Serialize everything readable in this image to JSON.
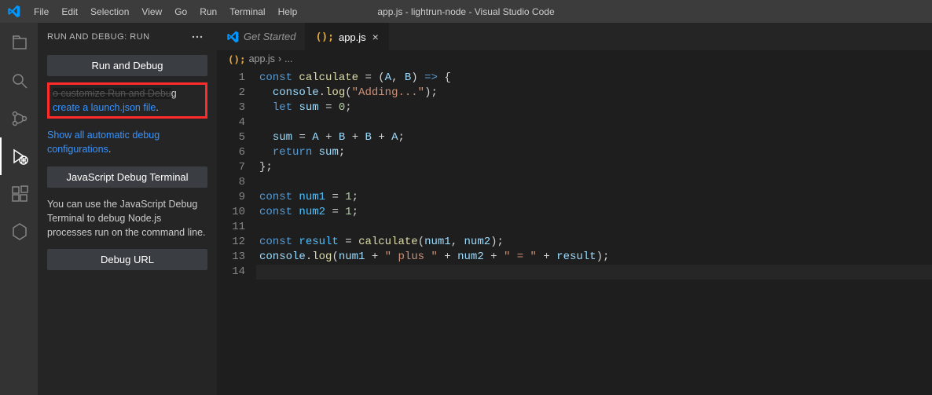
{
  "titlebar": {
    "title": "app.js - lightrun-node - Visual Studio Code",
    "menus": [
      "File",
      "Edit",
      "Selection",
      "View",
      "Go",
      "Run",
      "Terminal",
      "Help"
    ]
  },
  "activitybar": {
    "items": [
      "explorer",
      "search",
      "source-control",
      "run-debug",
      "extensions",
      "hexagon"
    ]
  },
  "sidebar": {
    "title": "RUN AND DEBUG: RUN",
    "run_and_debug_btn": "Run and Debug",
    "create_launch_line1_suffix": "g",
    "create_launch_link": "create a launch.json file",
    "create_launch_period": ".",
    "show_all_link": "Show all automatic debug configurations",
    "show_all_period": ".",
    "js_terminal_btn": "JavaScript Debug Terminal",
    "js_terminal_help": "You can use the JavaScript Debug Terminal to debug Node.js processes run on the command line.",
    "debug_url_btn": "Debug URL"
  },
  "tabs": {
    "get_started": "Get Started",
    "app_js": "app.js"
  },
  "breadcrumb": {
    "file": "app.js",
    "sep": "›",
    "more": "..."
  },
  "code": {
    "line_count": 14,
    "lines": [
      {
        "n": 1,
        "html": "<span class='kw'>const</span> <span class='fn'>calculate</span> <span class='op'>=</span> <span class='punct'>(</span><span class='param'>A</span><span class='punct'>,</span> <span class='param'>B</span><span class='punct'>)</span> <span class='kw'>=&gt;</span> <span class='punct'>{</span>"
      },
      {
        "n": 2,
        "html": "  <span class='param'>console</span><span class='punct'>.</span><span class='fn'>log</span><span class='punct'>(</span><span class='str'>\"Adding...\"</span><span class='punct'>);</span>"
      },
      {
        "n": 3,
        "html": "  <span class='kw'>let</span> <span class='param'>sum</span> <span class='op'>=</span> <span class='num'>0</span><span class='punct'>;</span>"
      },
      {
        "n": 4,
        "html": ""
      },
      {
        "n": 5,
        "html": "  <span class='param'>sum</span> <span class='op'>=</span> <span class='param'>A</span> <span class='op'>+</span> <span class='param'>B</span> <span class='op'>+</span> <span class='param'>B</span> <span class='op'>+</span> <span class='param'>A</span><span class='punct'>;</span>"
      },
      {
        "n": 6,
        "html": "  <span class='kw'>return</span> <span class='param'>sum</span><span class='punct'>;</span>"
      },
      {
        "n": 7,
        "html": "<span class='punct'>};</span>"
      },
      {
        "n": 8,
        "html": ""
      },
      {
        "n": 9,
        "html": "<span class='kw'>const</span> <span class='const'>num1</span> <span class='op'>=</span> <span class='num'>1</span><span class='punct'>;</span>"
      },
      {
        "n": 10,
        "html": "<span class='kw'>const</span> <span class='const'>num2</span> <span class='op'>=</span> <span class='num'>1</span><span class='punct'>;</span>"
      },
      {
        "n": 11,
        "html": ""
      },
      {
        "n": 12,
        "html": "<span class='kw'>const</span> <span class='const'>result</span> <span class='op'>=</span> <span class='fn'>calculate</span><span class='punct'>(</span><span class='param'>num1</span><span class='punct'>,</span> <span class='param'>num2</span><span class='punct'>);</span>"
      },
      {
        "n": 13,
        "html": "<span class='param'>console</span><span class='punct'>.</span><span class='fn'>log</span><span class='punct'>(</span><span class='param'>num1</span> <span class='op'>+</span> <span class='str'>\" plus \"</span> <span class='op'>+</span> <span class='param'>num2</span> <span class='op'>+</span> <span class='str'>\" = \"</span> <span class='op'>+</span> <span class='param'>result</span><span class='punct'>);</span>"
      },
      {
        "n": 14,
        "html": ""
      }
    ]
  }
}
